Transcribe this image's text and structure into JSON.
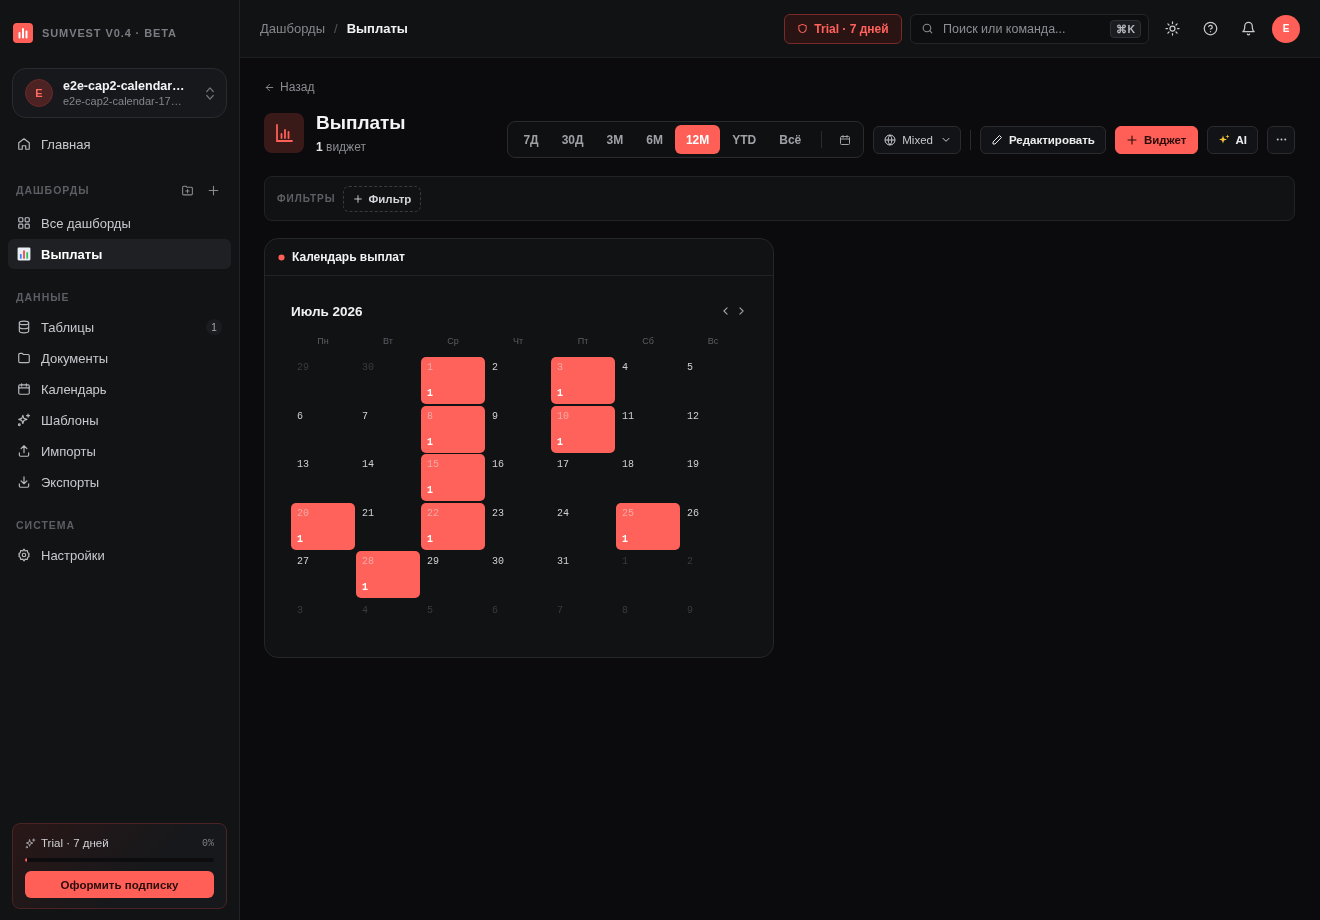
{
  "app": {
    "name": "SUMVEST V0.4 · BETA"
  },
  "workspace": {
    "avatar": "E",
    "name": "e2e-cap2-calendar…",
    "subtitle": "e2e-cap2-calendar-17…"
  },
  "sidebar": {
    "top_items": [
      {
        "label": "Главная",
        "selected": false
      }
    ],
    "sections": [
      {
        "title": "ДАШБОРДЫ",
        "items": [
          {
            "label": "Все дашборды",
            "selected": false
          },
          {
            "label": "Выплаты",
            "selected": true
          }
        ]
      },
      {
        "title": "ДАННЫЕ",
        "items": [
          {
            "label": "Таблицы",
            "selected": false,
            "badge": "1"
          },
          {
            "label": "Документы",
            "selected": false
          },
          {
            "label": "Календарь",
            "selected": false
          },
          {
            "label": "Шаблоны",
            "selected": false
          },
          {
            "label": "Импорты",
            "selected": false
          },
          {
            "label": "Экспорты",
            "selected": false
          }
        ]
      },
      {
        "title": "СИСТЕМА",
        "items": [
          {
            "label": "Настройки",
            "selected": false
          }
        ]
      }
    ],
    "trial_card": {
      "label": "Trial · 7 дней",
      "percent": "0%",
      "level": 0,
      "button": "Оформить подписку"
    }
  },
  "header": {
    "breadcrumbs": [
      {
        "label": "Дашборды",
        "current": false
      },
      {
        "label": "Выплаты",
        "current": true
      }
    ],
    "separator": "/",
    "trial_badge": "Trial · 7 дней",
    "search": {
      "placeholder": "Поиск или команда...",
      "shortcut": "⌘K"
    },
    "avatar": "E"
  },
  "page": {
    "back": "Назад",
    "title": "Выплаты",
    "subtitle": "**1** виджет",
    "periods": [
      {
        "label": "7Д",
        "selected": false
      },
      {
        "label": "30Д",
        "selected": false
      },
      {
        "label": "3М",
        "selected": false
      },
      {
        "label": "6М",
        "selected": false
      },
      {
        "label": "12М",
        "selected": true
      },
      {
        "label": "YTD",
        "selected": false
      },
      {
        "label": "Всё",
        "selected": false
      }
    ],
    "view_mode": "Mixed",
    "actions": [
      {
        "label": "Редактировать",
        "kind": "edit"
      },
      {
        "label": "Виджет",
        "kind": "add"
      },
      {
        "label": "AI",
        "kind": "ai"
      }
    ]
  },
  "filters": {
    "label": "ФИЛЬТРЫ",
    "add": "Фильтр"
  },
  "widgets": [
    {
      "title": "Календарь выплат",
      "month": "Июль 2026",
      "weekdays": [
        "Пн",
        "Вт",
        "Ср",
        "Чт",
        "Пт",
        "Сб",
        "Вс"
      ],
      "weeks": [
        [
          {
            "day": "29",
            "outside": true,
            "marked": false
          },
          {
            "day": "30",
            "outside": true,
            "marked": false
          },
          {
            "day": "1",
            "outside": false,
            "marked": true,
            "count": "1"
          },
          {
            "day": "2",
            "outside": false,
            "marked": false
          },
          {
            "day": "3",
            "outside": false,
            "marked": true,
            "count": "1"
          },
          {
            "day": "4",
            "outside": false,
            "marked": false
          },
          {
            "day": "5",
            "outside": false,
            "marked": false
          }
        ],
        [
          {
            "day": "6",
            "outside": false,
            "marked": false
          },
          {
            "day": "7",
            "outside": false,
            "marked": false
          },
          {
            "day": "8",
            "outside": false,
            "marked": true,
            "count": "1"
          },
          {
            "day": "9",
            "outside": false,
            "marked": false
          },
          {
            "day": "10",
            "outside": false,
            "marked": true,
            "count": "1"
          },
          {
            "day": "11",
            "outside": false,
            "marked": false
          },
          {
            "day": "12",
            "outside": false,
            "marked": false
          }
        ],
        [
          {
            "day": "13",
            "outside": false,
            "marked": false
          },
          {
            "day": "14",
            "outside": false,
            "marked": false
          },
          {
            "day": "15",
            "outside": false,
            "marked": true,
            "count": "1"
          },
          {
            "day": "16",
            "outside": false,
            "marked": false
          },
          {
            "day": "17",
            "outside": false,
            "marked": false
          },
          {
            "day": "18",
            "outside": false,
            "marked": false
          },
          {
            "day": "19",
            "outside": false,
            "marked": false
          }
        ],
        [
          {
            "day": "20",
            "outside": false,
            "marked": true,
            "count": "1"
          },
          {
            "day": "21",
            "outside": false,
            "marked": false
          },
          {
            "day": "22",
            "outside": false,
            "marked": true,
            "count": "1"
          },
          {
            "day": "23",
            "outside": false,
            "marked": false
          },
          {
            "day": "24",
            "outside": false,
            "marked": false
          },
          {
            "day": "25",
            "outside": false,
            "marked": true,
            "count": "1"
          },
          {
            "day": "26",
            "outside": false,
            "marked": false
          }
        ],
        [
          {
            "day": "27",
            "outside": false,
            "marked": false
          },
          {
            "day": "28",
            "outside": false,
            "marked": true,
            "count": "1"
          },
          {
            "day": "29",
            "outside": false,
            "marked": false
          },
          {
            "day": "30",
            "outside": false,
            "marked": false
          },
          {
            "day": "31",
            "outside": false,
            "marked": false
          },
          {
            "day": "1",
            "outside": true,
            "marked": false
          },
          {
            "day": "2",
            "outside": true,
            "marked": false
          }
        ],
        [
          {
            "day": "3",
            "outside": true,
            "marked": false
          },
          {
            "day": "4",
            "outside": true,
            "marked": false
          },
          {
            "day": "5",
            "outside": true,
            "marked": false
          },
          {
            "day": "6",
            "outside": true,
            "marked": false
          },
          {
            "day": "7",
            "outside": true,
            "marked": false
          },
          {
            "day": "8",
            "outside": true,
            "marked": false
          },
          {
            "day": "9",
            "outside": true,
            "marked": false
          }
        ]
      ]
    }
  ]
}
